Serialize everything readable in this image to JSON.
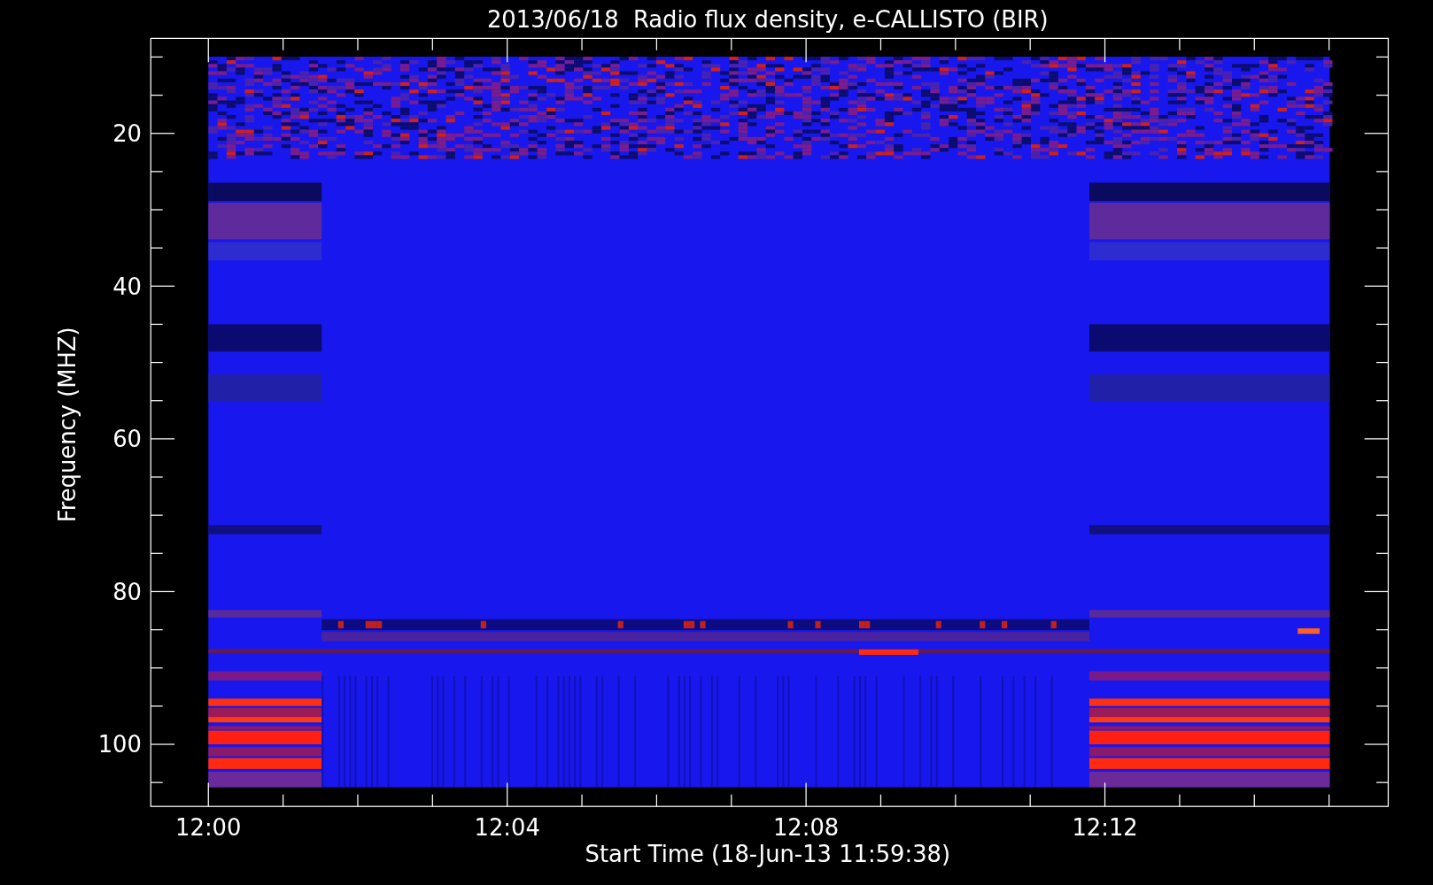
{
  "title": "2013/06/18  Radio flux density, e-CALLISTO (BIR)",
  "y_axis": {
    "label": "Frequency (MHZ)",
    "ticks": [
      "20",
      "40",
      "60",
      "80",
      "100"
    ]
  },
  "x_axis": {
    "label": "Start Time (18-Jun-13 11:59:38)",
    "ticks": [
      "12:00",
      "12:04",
      "12:08",
      "12:12"
    ]
  }
}
